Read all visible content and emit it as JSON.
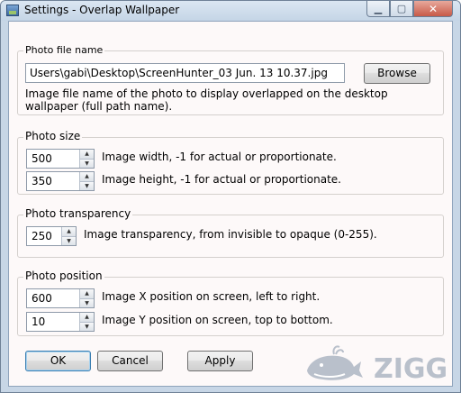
{
  "window": {
    "title": "Settings - Overlap Wallpaper"
  },
  "photo_file": {
    "legend": "Photo file name",
    "path_value": "Users\\gabi\\Desktop\\ScreenHunter_03 Jun. 13 10.37.jpg",
    "browse_label": "Browse",
    "description_line1": "Image file name of the photo to display overlapped on the desktop",
    "description_line2": "wallpaper (full path name)."
  },
  "photo_size": {
    "legend": "Photo size",
    "width_value": "500",
    "width_desc": "Image width, -1 for actual or proportionate.",
    "height_value": "350",
    "height_desc": "Image height, -1 for actual or proportionate."
  },
  "photo_transparency": {
    "legend": "Photo transparency",
    "value": "250",
    "desc": "Image transparency, from invisible to opaque (0-255)."
  },
  "photo_position": {
    "legend": "Photo position",
    "x_value": "600",
    "x_desc": "Image X position on screen, left to right.",
    "y_value": "10",
    "y_desc": "Image Y position on screen, top to bottom."
  },
  "buttons": {
    "ok": "OK",
    "cancel": "Cancel",
    "apply": "Apply"
  },
  "watermark": {
    "text": "ZIGG",
    "icon": "whale-logo"
  },
  "colors": {
    "accent": "#3c7fb1",
    "watermark": "#b9c0cb"
  }
}
